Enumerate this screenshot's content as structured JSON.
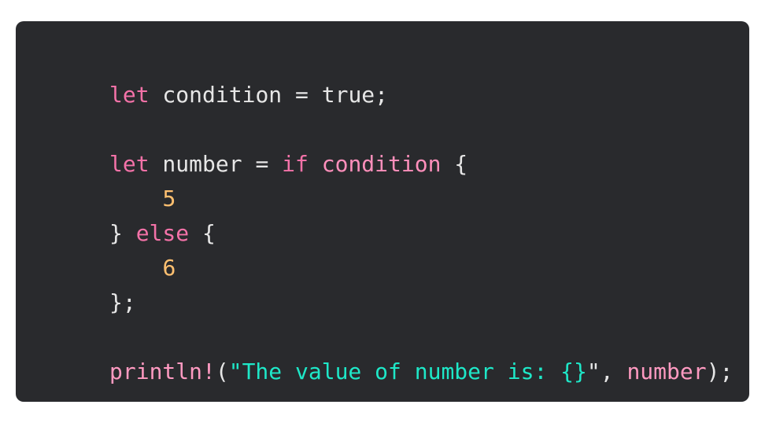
{
  "code": {
    "language": "rust",
    "colors": {
      "keyword": "#f472a8",
      "identifier": "#ff8fbb",
      "macro": "#ff9ac1",
      "string": "#1ee8c8",
      "number": "#ffc070",
      "plain": "#e6e6e6",
      "background": "#292a2d"
    },
    "lines": [
      [
        {
          "t": "let",
          "k": "kw"
        },
        {
          "t": " condition = true;",
          "k": "plain"
        }
      ],
      [],
      [
        {
          "t": "let",
          "k": "kw"
        },
        {
          "t": " number = ",
          "k": "plain"
        },
        {
          "t": "if",
          "k": "kw"
        },
        {
          "t": " ",
          "k": "plain"
        },
        {
          "t": "condition",
          "k": "id2"
        },
        {
          "t": " {",
          "k": "plain"
        }
      ],
      [
        {
          "t": "    ",
          "k": "plain"
        },
        {
          "t": "5",
          "k": "num"
        }
      ],
      [
        {
          "t": "} ",
          "k": "plain"
        },
        {
          "t": "else",
          "k": "kw"
        },
        {
          "t": " {",
          "k": "plain"
        }
      ],
      [
        {
          "t": "    ",
          "k": "plain"
        },
        {
          "t": "6",
          "k": "num"
        }
      ],
      [
        {
          "t": "};",
          "k": "plain"
        }
      ],
      [],
      [
        {
          "t": "println!",
          "k": "mac"
        },
        {
          "t": "(",
          "k": "plain"
        },
        {
          "t": "\"The value of number is: {}",
          "k": "str"
        },
        {
          "t": "\", ",
          "k": "plain"
        },
        {
          "t": "number",
          "k": "mac"
        },
        {
          "t": ");",
          "k": "plain"
        }
      ]
    ]
  }
}
